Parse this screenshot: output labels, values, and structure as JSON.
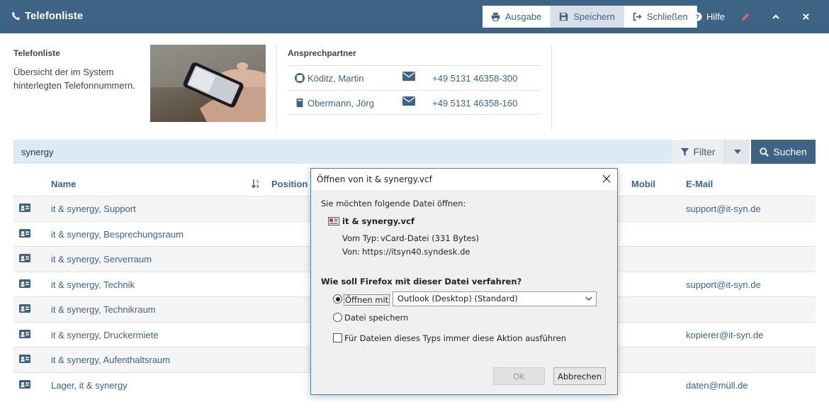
{
  "header": {
    "title": "Telefonliste",
    "toolbar": {
      "ausgabe": "Ausgabe",
      "speichern": "Speichern",
      "schliessen": "Schließen",
      "hilfe": "Hilfe"
    }
  },
  "info": {
    "title": "Telefonliste",
    "description": "Übersicht der im System hinterlegten Telefonnummern."
  },
  "contacts": {
    "title": "Ansprechpartner",
    "items": [
      {
        "name": "Köditz, Martin",
        "phone": "+49 5131 46358-300"
      },
      {
        "name": "Obermann, Jörg",
        "phone": "+49 5131 46358-160"
      }
    ]
  },
  "search": {
    "value": "synergy",
    "filter_label": "Filter",
    "search_label": "Suchen"
  },
  "table": {
    "columns": {
      "name": "Name",
      "position": "Position",
      "mobil": "Mobil",
      "email": "E-Mail"
    },
    "rows": [
      {
        "name": "it & synergy, Support",
        "email": "support@it-syn.de"
      },
      {
        "name": "it & synergy, Besprechungsraum",
        "email": ""
      },
      {
        "name": "it & synergy, Serverraum",
        "email": ""
      },
      {
        "name": "it & synergy, Technik",
        "email": "support@it-syn.de"
      },
      {
        "name": "it & synergy, Technikraum",
        "email": ""
      },
      {
        "name": "it & synergy, Druckermiete",
        "email": "kopierer@it-syn.de"
      },
      {
        "name": "it & synergy, Aufenthaltsraum",
        "email": ""
      },
      {
        "name": "Lager, it & synergy",
        "email": "daten@müll.de"
      }
    ]
  },
  "dialog": {
    "title": "Öffnen von it & synergy.vcf",
    "prompt": "Sie möchten folgende Datei öffnen:",
    "filename": "it & synergy.vcf",
    "type_label": "Vom Typ:",
    "type_value": "vCard-Datei (331 Bytes)",
    "from_label": "Von:",
    "from_value": "https://itsyn40.syndesk.de",
    "question": "Wie soll Firefox mit dieser Datei verfahren?",
    "open_with_label": "Öffnen mit",
    "open_with_selected": "Outlook (Desktop) (Standard)",
    "save_label": "Datei speichern",
    "always_label": "Für Dateien dieses Typs immer diese Aktion ausführen",
    "ok_label": "OK",
    "cancel_label": "Abbrechen"
  }
}
